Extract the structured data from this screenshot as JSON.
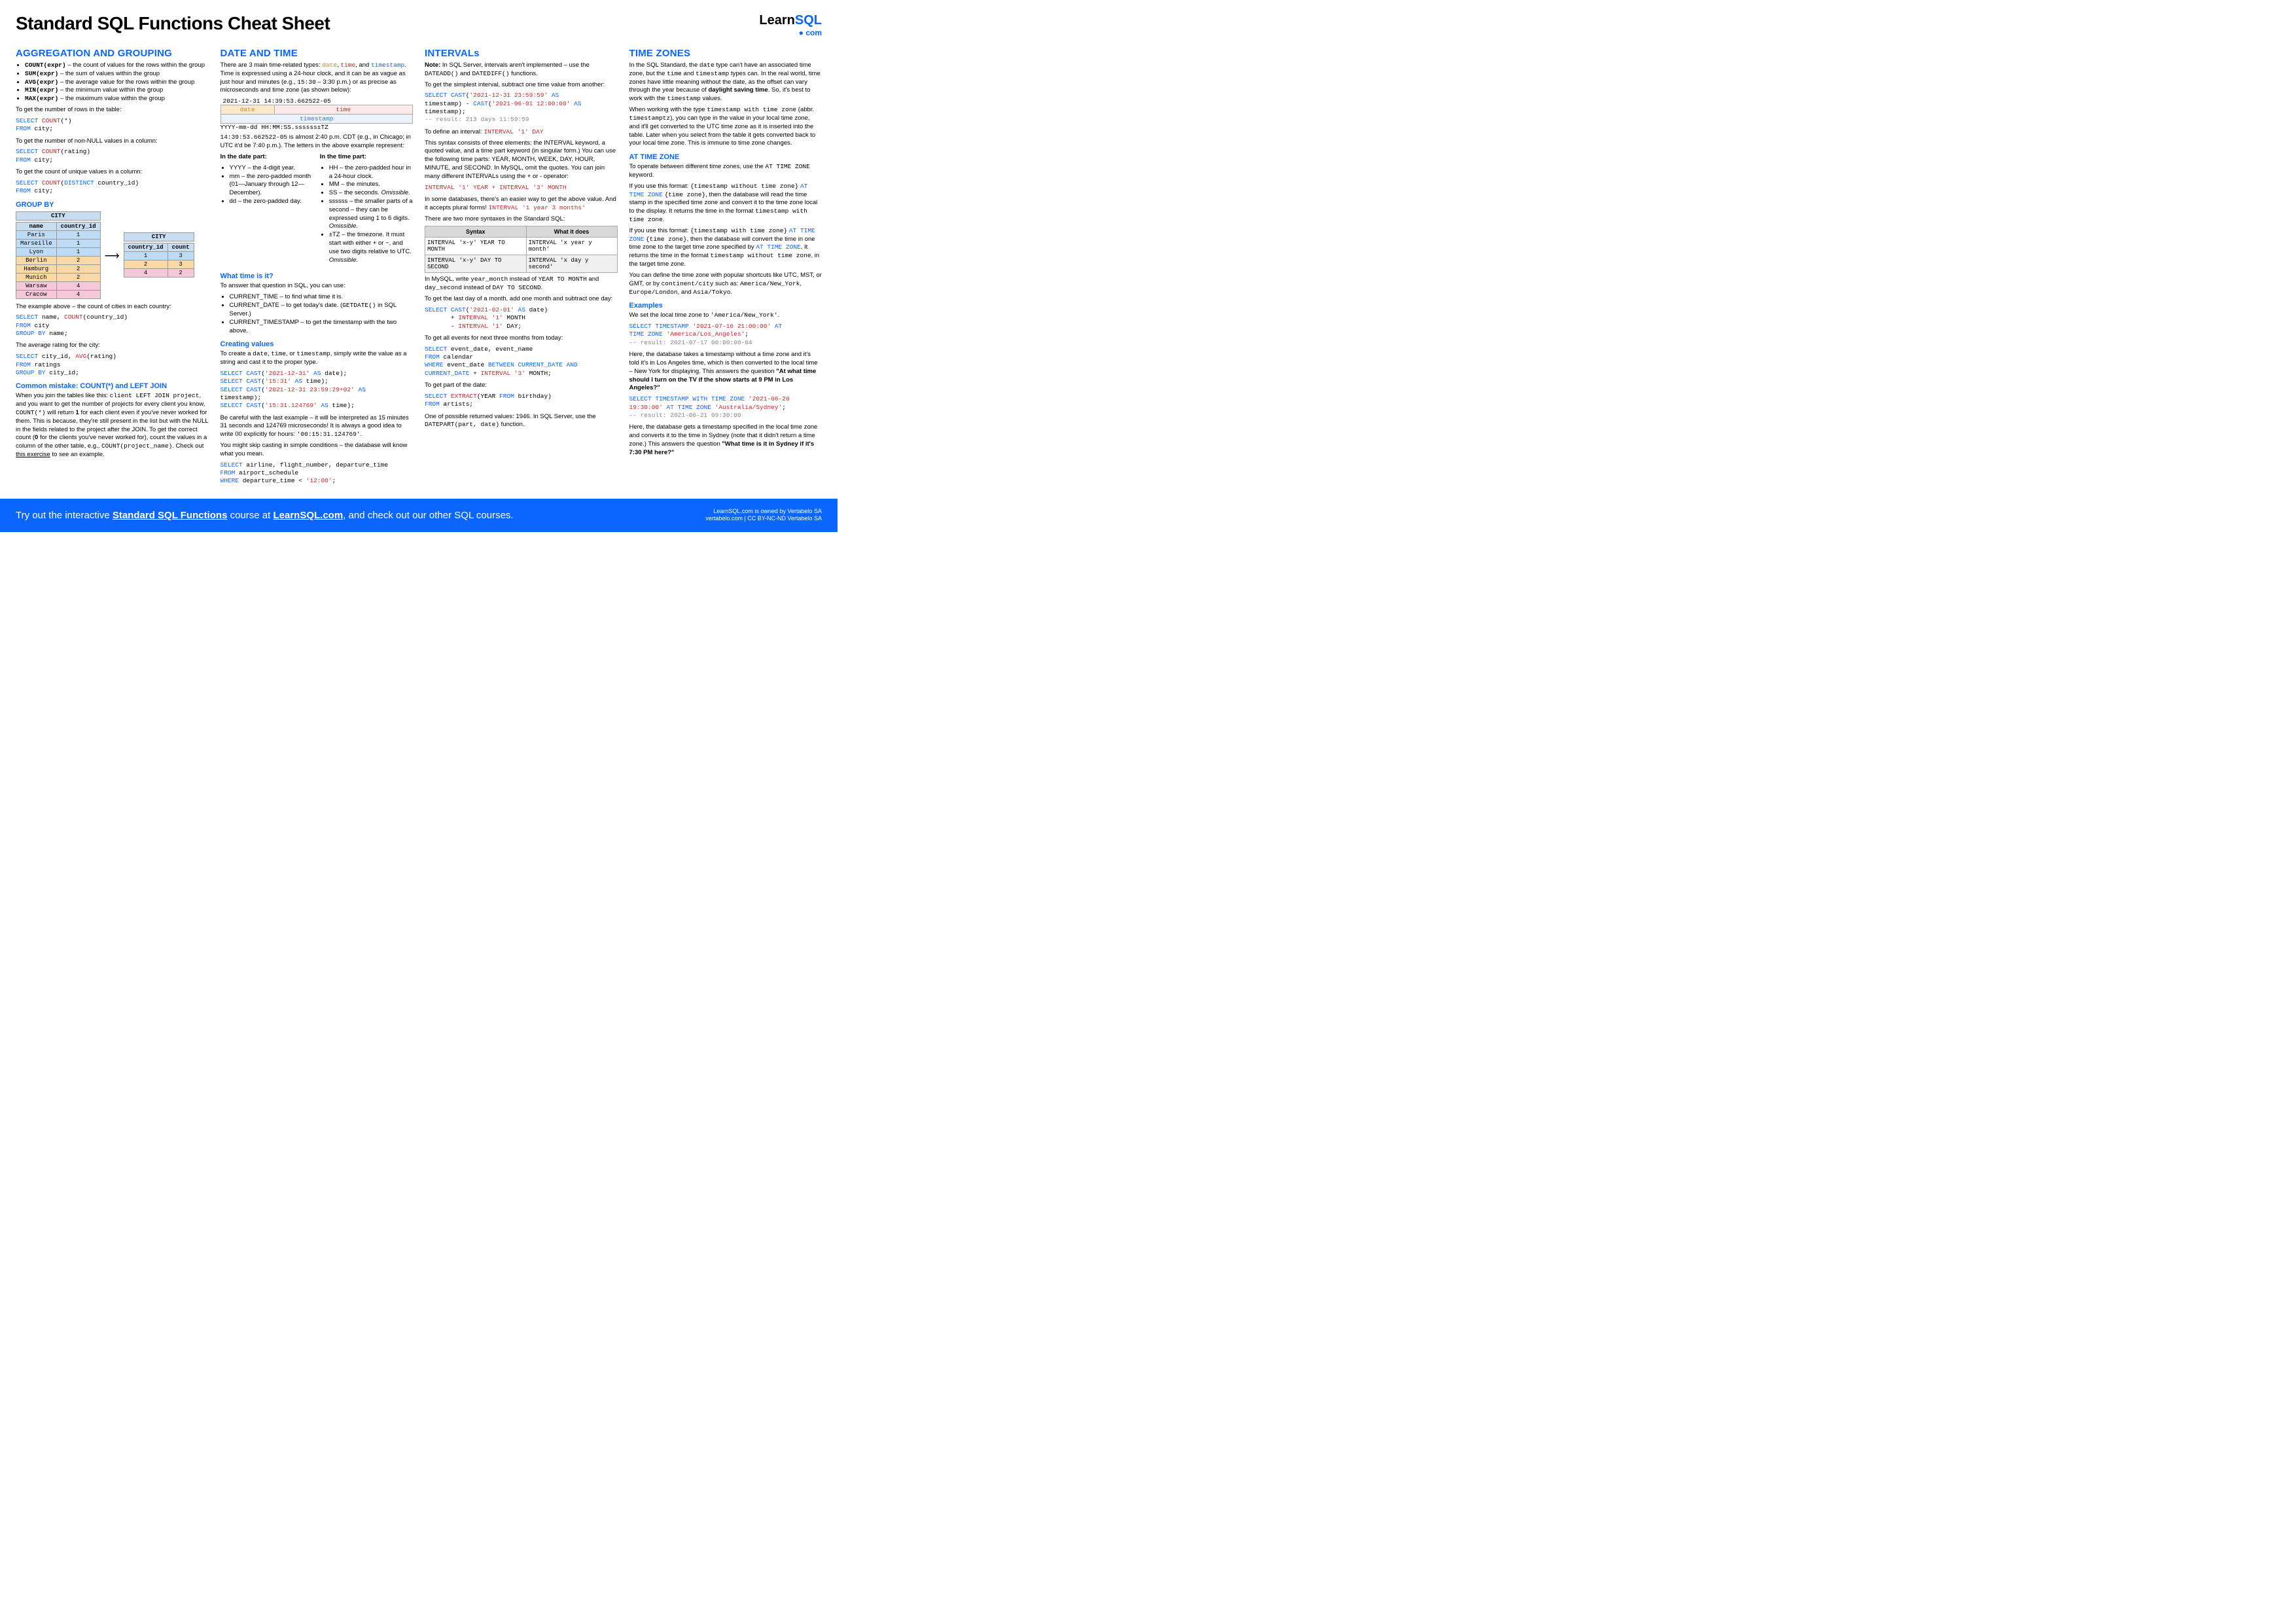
{
  "header": {
    "title": "Standard SQL Functions Cheat Sheet",
    "logo_learn": "Learn",
    "logo_sql": "SQL",
    "logo_sub": "● com"
  },
  "col1": {
    "h_agg": "AGGREGATION AND GROUPING",
    "agg_items": [
      {
        "fn": "COUNT(expr)",
        "desc": " – the count of values for the rows within the group"
      },
      {
        "fn": "SUM(expr)",
        "desc": " – the sum of values within the group"
      },
      {
        "fn": "AVG(expr)",
        "desc": " – the average value for the rows within the group"
      },
      {
        "fn": "MIN(expr)",
        "desc": " – the minimum value within the group"
      },
      {
        "fn": "MAX(expr)",
        "desc": " – the maximum value within the group"
      }
    ],
    "p_rows": "To get the number of rows in the table:",
    "code_rows_1": "SELECT",
    "code_rows_2": "COUNT",
    "code_rows_3": "(*)",
    "code_rows_4": "FROM",
    "code_rows_5": " city;",
    "p_nonnull": "To get the number of non-NULL values in a column:",
    "code_nn_1": "SELECT",
    "code_nn_2": "COUNT",
    "code_nn_3": "(rating)",
    "code_nn_4": "FROM",
    "code_nn_5": " city;",
    "p_unique": "To get the count of unique values in a column:",
    "code_un_1": "SELECT",
    "code_un_2": "COUNT",
    "code_un_3": "(",
    "code_un_4": "DISTINCT",
    "code_un_5": " country_id)",
    "code_un_6": "FROM",
    "code_un_7": " city;",
    "h_groupby": "GROUP BY",
    "tbl_city_title": "CITY",
    "tbl_city_h1": "name",
    "tbl_city_h2": "country_id",
    "tbl_city_rows": [
      {
        "name": "Paris",
        "cid": "1",
        "cls": "row-blue"
      },
      {
        "name": "Marseille",
        "cid": "1",
        "cls": "row-blue"
      },
      {
        "name": "Lyon",
        "cid": "1",
        "cls": "row-blue"
      },
      {
        "name": "Berlin",
        "cid": "2",
        "cls": "row-orange"
      },
      {
        "name": "Hamburg",
        "cid": "2",
        "cls": "row-orange"
      },
      {
        "name": "Munich",
        "cid": "2",
        "cls": "row-orange"
      },
      {
        "name": "Warsaw",
        "cid": "4",
        "cls": "row-pink"
      },
      {
        "name": "Cracow",
        "cid": "4",
        "cls": "row-pink"
      }
    ],
    "tbl_res_title": "CITY",
    "tbl_res_h1": "country_id",
    "tbl_res_h2": "count",
    "tbl_res_rows": [
      {
        "cid": "1",
        "cnt": "3",
        "cls": "row-blue"
      },
      {
        "cid": "2",
        "cnt": "3",
        "cls": "row-orange"
      },
      {
        "cid": "4",
        "cnt": "2",
        "cls": "row-pink"
      }
    ],
    "p_example": "The example above – the count of cities in each country:",
    "code_ex_1": "SELECT",
    "code_ex_2": " name, ",
    "code_ex_3": "COUNT",
    "code_ex_4": "(country_id)",
    "code_ex_5": "FROM",
    "code_ex_6": " city",
    "code_ex_7": "GROUP BY",
    "code_ex_8": " name;",
    "p_avg": "The average rating for the city:",
    "code_av_1": "SELECT",
    "code_av_2": " city_id, ",
    "code_av_3": "AVG",
    "code_av_4": "(rating)",
    "code_av_5": "FROM",
    "code_av_6": " ratings",
    "code_av_7": "GROUP BY",
    "code_av_8": " city_id;",
    "h_mistake": "Common mistake: COUNT(*) and LEFT JOIN",
    "p_mistake_a": "When you join the tables like this: ",
    "p_mistake_b": "client LEFT JOIN project",
    "p_mistake_c": ", and you want to get the number of projects for every client you know, ",
    "p_mistake_d": "COUNT(*)",
    "p_mistake_e": " will return ",
    "p_mistake_f": "1",
    "p_mistake_g": " for each client even if you've never worked for them. This is because, they're still present in the list but with the NULL in the fields related to the project after the JOIN. To get the correct count (",
    "p_mistake_h": "0",
    "p_mistake_i": " for the clients you've never worked for), count the values in a column of the other table, e.g., ",
    "p_mistake_j": "COUNT(project_name)",
    "p_mistake_k": ". Check out ",
    "p_mistake_l": "this exercise",
    "p_mistake_m": " to see an example."
  },
  "col2": {
    "h_date": "DATE AND TIME",
    "p_intro_a": "There are 3 main time-related types: ",
    "p_intro_date": "date",
    "p_intro_b": ", ",
    "p_intro_time": "time",
    "p_intro_c": ", and ",
    "p_intro_ts": "timestamp",
    "p_intro_d": ". Time is expressed using a 24-hour clock, and it can be as vague as just hour and minutes (e.g., ",
    "p_intro_e": "15:30",
    "p_intro_f": " – 3:30 p.m.) or as precise as microseconds and time zone (as shown below):",
    "ts_full": "2021-12-31 14:39:53.662522-05",
    "ts_date_lbl": "date",
    "ts_time_lbl": "time",
    "ts_stamp_lbl": "timestamp",
    "ts_fmt": " YYYY-mm-dd HH:MM:SS.ssssss±TZ",
    "p_almost_a": "14:39:53.662522-05",
    "p_almost_b": " is almost 2:40 p.m. CDT (e.g., in Chicago; in UTC it'd be 7:40 p.m.). The letters in the above example represent:",
    "h_datepart": "In the date part:",
    "date_items": [
      "YYYY – the 4-digit year.",
      "mm – the zero-padded month (01—January through 12—December).",
      "dd – the zero-padded day."
    ],
    "h_timepart": "In the time part:",
    "time_items_a": "HH – the zero-padded hour in a 24-hour clock.",
    "time_items_b": "MM – the minutes.",
    "time_items_c_a": "SS – the seconds. ",
    "time_items_c_b": "Omissible.",
    "time_items_d_a": "ssssss – the smaller parts of a second – they can be expressed using 1 to 6 digits. ",
    "time_items_d_b": "Omissible.",
    "time_items_e_a": "±TZ – the timezone. It must start with either + or −, and use two digits relative to UTC. ",
    "time_items_e_b": "Omissible.",
    "h_whattime": "What time is it?",
    "p_whattime": "To answer that question in SQL, you can use:",
    "wt_a": "CURRENT_TIME – to find what time it is.",
    "wt_b_a": "CURRENT_DATE – to get today's date. (",
    "wt_b_b": "GETDATE()",
    "wt_b_c": " in SQL Server.)",
    "wt_c": "CURRENT_TIMESTAMP – to get the timestamp with the two above.",
    "h_creating": "Creating values",
    "p_creating_a": "To create a ",
    "p_creating_b": "date",
    "p_creating_c": ", ",
    "p_creating_d": "time",
    "p_creating_e": ", or ",
    "p_creating_f": "timestamp",
    "p_creating_g": ", simply write the value as a string and cast it to the proper type.",
    "cc1": "SELECT CAST('2021-12-31' AS date);",
    "cc2": "SELECT CAST('15:31' AS time);",
    "cc3": "SELECT CAST('2021-12-31 23:59:29+02' AS timestamp);",
    "cc4": "SELECT CAST('15:31.124769' AS time);",
    "p_careful_a": "Be careful with the last example – it will be interpreted as 15 minutes 31 seconds and 124769 microseconds! It is always a good idea to write 00 explicitly for hours: ",
    "p_careful_b": "'00:15:31.124769'",
    "p_careful_c": ".",
    "p_skip": "You might skip casting in simple conditions – the database will know what you mean.",
    "cs_1": "SELECT",
    "cs_2": " airline, flight_number, departure_time",
    "cs_3": "FROM",
    "cs_4": " airport_schedule",
    "cs_5": "WHERE",
    "cs_6": " departure_time < ",
    "cs_7": "'12:00'",
    "cs_8": ";"
  },
  "col3": {
    "h_int": "INTERVALs",
    "p_note_a": "Note:",
    "p_note_b": " In SQL Server, intervals aren't implemented – use the ",
    "p_note_c": "DATEADD()",
    "p_note_d": " and ",
    "p_note_e": "DATEDIFF()",
    "p_note_f": " functions.",
    "p_simple": "To get the simplest interval, subtract one time value from another:",
    "ci_1": "SELECT CAST",
    "ci_2": "(",
    "ci_3": "'2021-12-31 23:59:59'",
    "ci_4": " AS",
    "ci_5": "timestamp) - ",
    "ci_6": "CAST",
    "ci_7": "(",
    "ci_8": "'2021-06-01 12:00:00'",
    "ci_9": " AS",
    "ci_10": "timestamp);",
    "ci_res": "-- result: 213 days 11:59:59",
    "p_def_a": "To define an interval: ",
    "p_def_b": "INTERVAL '1' DAY",
    "p_def_c": "This syntax consists of three elements: the INTERVAL keyword, a quoted value, and a time part keyword (in singular form.) You can use the following time parts: YEAR, MONTH, WEEK, DAY, HOUR, MINUTE, and SECOND. In MySQL, omit the quotes. You can join many different INTERVALs using the + or - operator:",
    "p_def_code": "INTERVAL '1' YEAR + INTERVAL '3' MONTH",
    "p_easier_a": "In some databases, there's an easier way to get the above value. And it accepts plural forms! ",
    "p_easier_b": "INTERVAL '1 year 3 months'",
    "p_two": "There are two more syntaxes in the Standard SQL:",
    "syn_h1": "Syntax",
    "syn_h2": "What it does",
    "syn_r1c1": "INTERVAL 'x-y' YEAR TO MONTH",
    "syn_r1c2": "INTERVAL 'x year y month'",
    "syn_r2c1": "INTERVAL 'x-y' DAY TO SECOND",
    "syn_r2c2": "INTERVAL 'x day y second'",
    "p_mysql_a": "In MySQL, write ",
    "p_mysql_b": "year_month",
    "p_mysql_c": " instead of ",
    "p_mysql_d": "YEAR TO MONTH",
    "p_mysql_e": " and ",
    "p_mysql_f": "day_second",
    "p_mysql_g": " instead of ",
    "p_mysql_h": "DAY TO SECOND",
    "p_mysql_i": ".",
    "p_last": "To get the last day of a month, add one month and subtract one day:",
    "cl_1": "SELECT CAST",
    "cl_2": "(",
    "cl_3": "'2021-02-01'",
    "cl_4": " AS",
    "cl_5": " date)",
    "cl_6": "       + ",
    "cl_7": "INTERVAL '1'",
    "cl_8": " MONTH",
    "cl_9": "       - ",
    "cl_10": "INTERVAL '1'",
    "cl_11": " DAY;",
    "p_events": "To get all events for next three months from today:",
    "ce_1": "SELECT",
    "ce_2": " event_date, event_name",
    "ce_3": "FROM",
    "ce_4": " calendar",
    "ce_5": "WHERE",
    "ce_6": " event_date ",
    "ce_7": "BETWEEN CURRENT_DATE AND",
    "ce_8": "CURRENT_DATE",
    "ce_9": " + ",
    "ce_10": "INTERVAL '3'",
    "ce_11": " MONTH;",
    "p_part": "To get part of the date:",
    "cp_1": "SELECT ",
    "cp_2": "EXTRACT",
    "cp_3": "(YEAR ",
    "cp_4": "FROM",
    "cp_5": " birthday)",
    "cp_6": "FROM",
    "cp_7": " artists;",
    "p_ret_a": "One of possible returned values: 1946. In SQL Server, use the ",
    "p_ret_b": "DATEPART(part, date)",
    "p_ret_c": " function."
  },
  "col4": {
    "h_tz": "TIME ZONES",
    "p1_a": "In the SQL Standard, the ",
    "p1_b": "date",
    "p1_c": " type can't have an associated time zone, but the ",
    "p1_d": "time",
    "p1_e": " and ",
    "p1_f": "timestamp",
    "p1_g": " types can. In the real world, time zones have little meaning without the date, as the offset can vary through the year because of ",
    "p1_h": "daylight saving time",
    "p1_i": ". So, it's best to work with the ",
    "p1_j": "timestamp",
    "p1_k": " values.",
    "p2_a": "When working with the type ",
    "p2_b": "timestamp with time zone",
    "p2_c": " (abbr. ",
    "p2_d": "timestamptz",
    "p2_e": "), you can type in the value in your local time zone, and it'll get converted to the UTC time zone as it is inserted into the table. Later when you select from the table it gets converted back to your local time zone. This is immune to time zone changes.",
    "h_atz": "AT TIME ZONE",
    "p3_a": "To operate between different time zones, use the ",
    "p3_b": "AT TIME ZONE",
    "p3_c": " keyword.",
    "p4_a": "If you use this format: ",
    "p4_b": "{timestamp without time zone}",
    "p4_c": " ",
    "p4_d": "AT TIME ZONE",
    "p4_e": " ",
    "p4_f": "{time zone}",
    "p4_g": ", then the database will read the time stamp in the specified time zone and convert it to the time zone local to the display. It returns the time in the format ",
    "p4_h": "timestamp with time zone",
    "p4_i": ".",
    "p5_a": "If you use this format: ",
    "p5_b": "{timestamp with time zone}",
    "p5_c": " ",
    "p5_d": "AT TIME ZONE",
    "p5_e": " ",
    "p5_f": "{time zone}",
    "p5_g": ", then the database will convert the time in one time zone to the target time zone specified by ",
    "p5_h": "AT TIME ZONE",
    "p5_i": ". It returns the time in the format ",
    "p5_j": "timestamp without time zone",
    "p5_k": ", in the target time zone.",
    "p6_a": "You can define the time zone with popular shortcuts like UTC, MST, or GMT, or by ",
    "p6_b": "continent/city",
    "p6_c": " such as: ",
    "p6_d": "America/New_York",
    "p6_e": ", ",
    "p6_f": "Europe/London",
    "p6_g": ", and ",
    "p6_h": "Asia/Tokyo",
    "p6_i": ".",
    "h_ex": "Examples",
    "pex_a": "We set the local time zone to ",
    "pex_b": "'America/New_York'",
    "pex_c": ".",
    "cex1_1": "SELECT TIMESTAMP",
    "cex1_2": " '2021-07-16 21:00:00'",
    "cex1_3": " AT",
    "cex1_4": "TIME ZONE",
    "cex1_5": " 'America/Los_Angeles'",
    "cex1_6": ";",
    "cex1_res": "-- result: 2021-07-17 00:00:00-04",
    "pex2_a": "Here, the database takes a timestamp without a time zone and it's told it's in Los Angeles time, which is then converted to the local time – New York for displaying. This answers the question ",
    "pex2_b": "\"At what time should I turn on the TV if the show starts at 9 PM in Los Angeles?\"",
    "cex2_1": "SELECT TIMESTAMP WITH TIME ZONE",
    "cex2_2": " '2021-06-20",
    "cex2_3": "19:30:00'",
    "cex2_4": " AT TIME ZONE",
    "cex2_5": " 'Australia/Sydney'",
    "cex2_6": ";",
    "cex2_res": "-- result: 2021-06-21 09:30:00",
    "pex3_a": "Here, the database gets a timestamp specified in the local time zone and converts it to the time in Sydney (note that it didn't return a time zone.) This answers the question ",
    "pex3_b": "\"What time is it in Sydney if it's 7:30 PM here?\""
  },
  "footer": {
    "main_a": "Try out the interactive ",
    "main_b": "Standard SQL Functions",
    "main_c": " course at ",
    "main_d": "LearnSQL.com",
    "main_e": ", and check out our other SQL courses.",
    "right_a": "LearnSQL.com is owned by Vertabelo SA",
    "right_b": "vertabelo.com | CC BY-NC-ND Vertabelo SA"
  }
}
